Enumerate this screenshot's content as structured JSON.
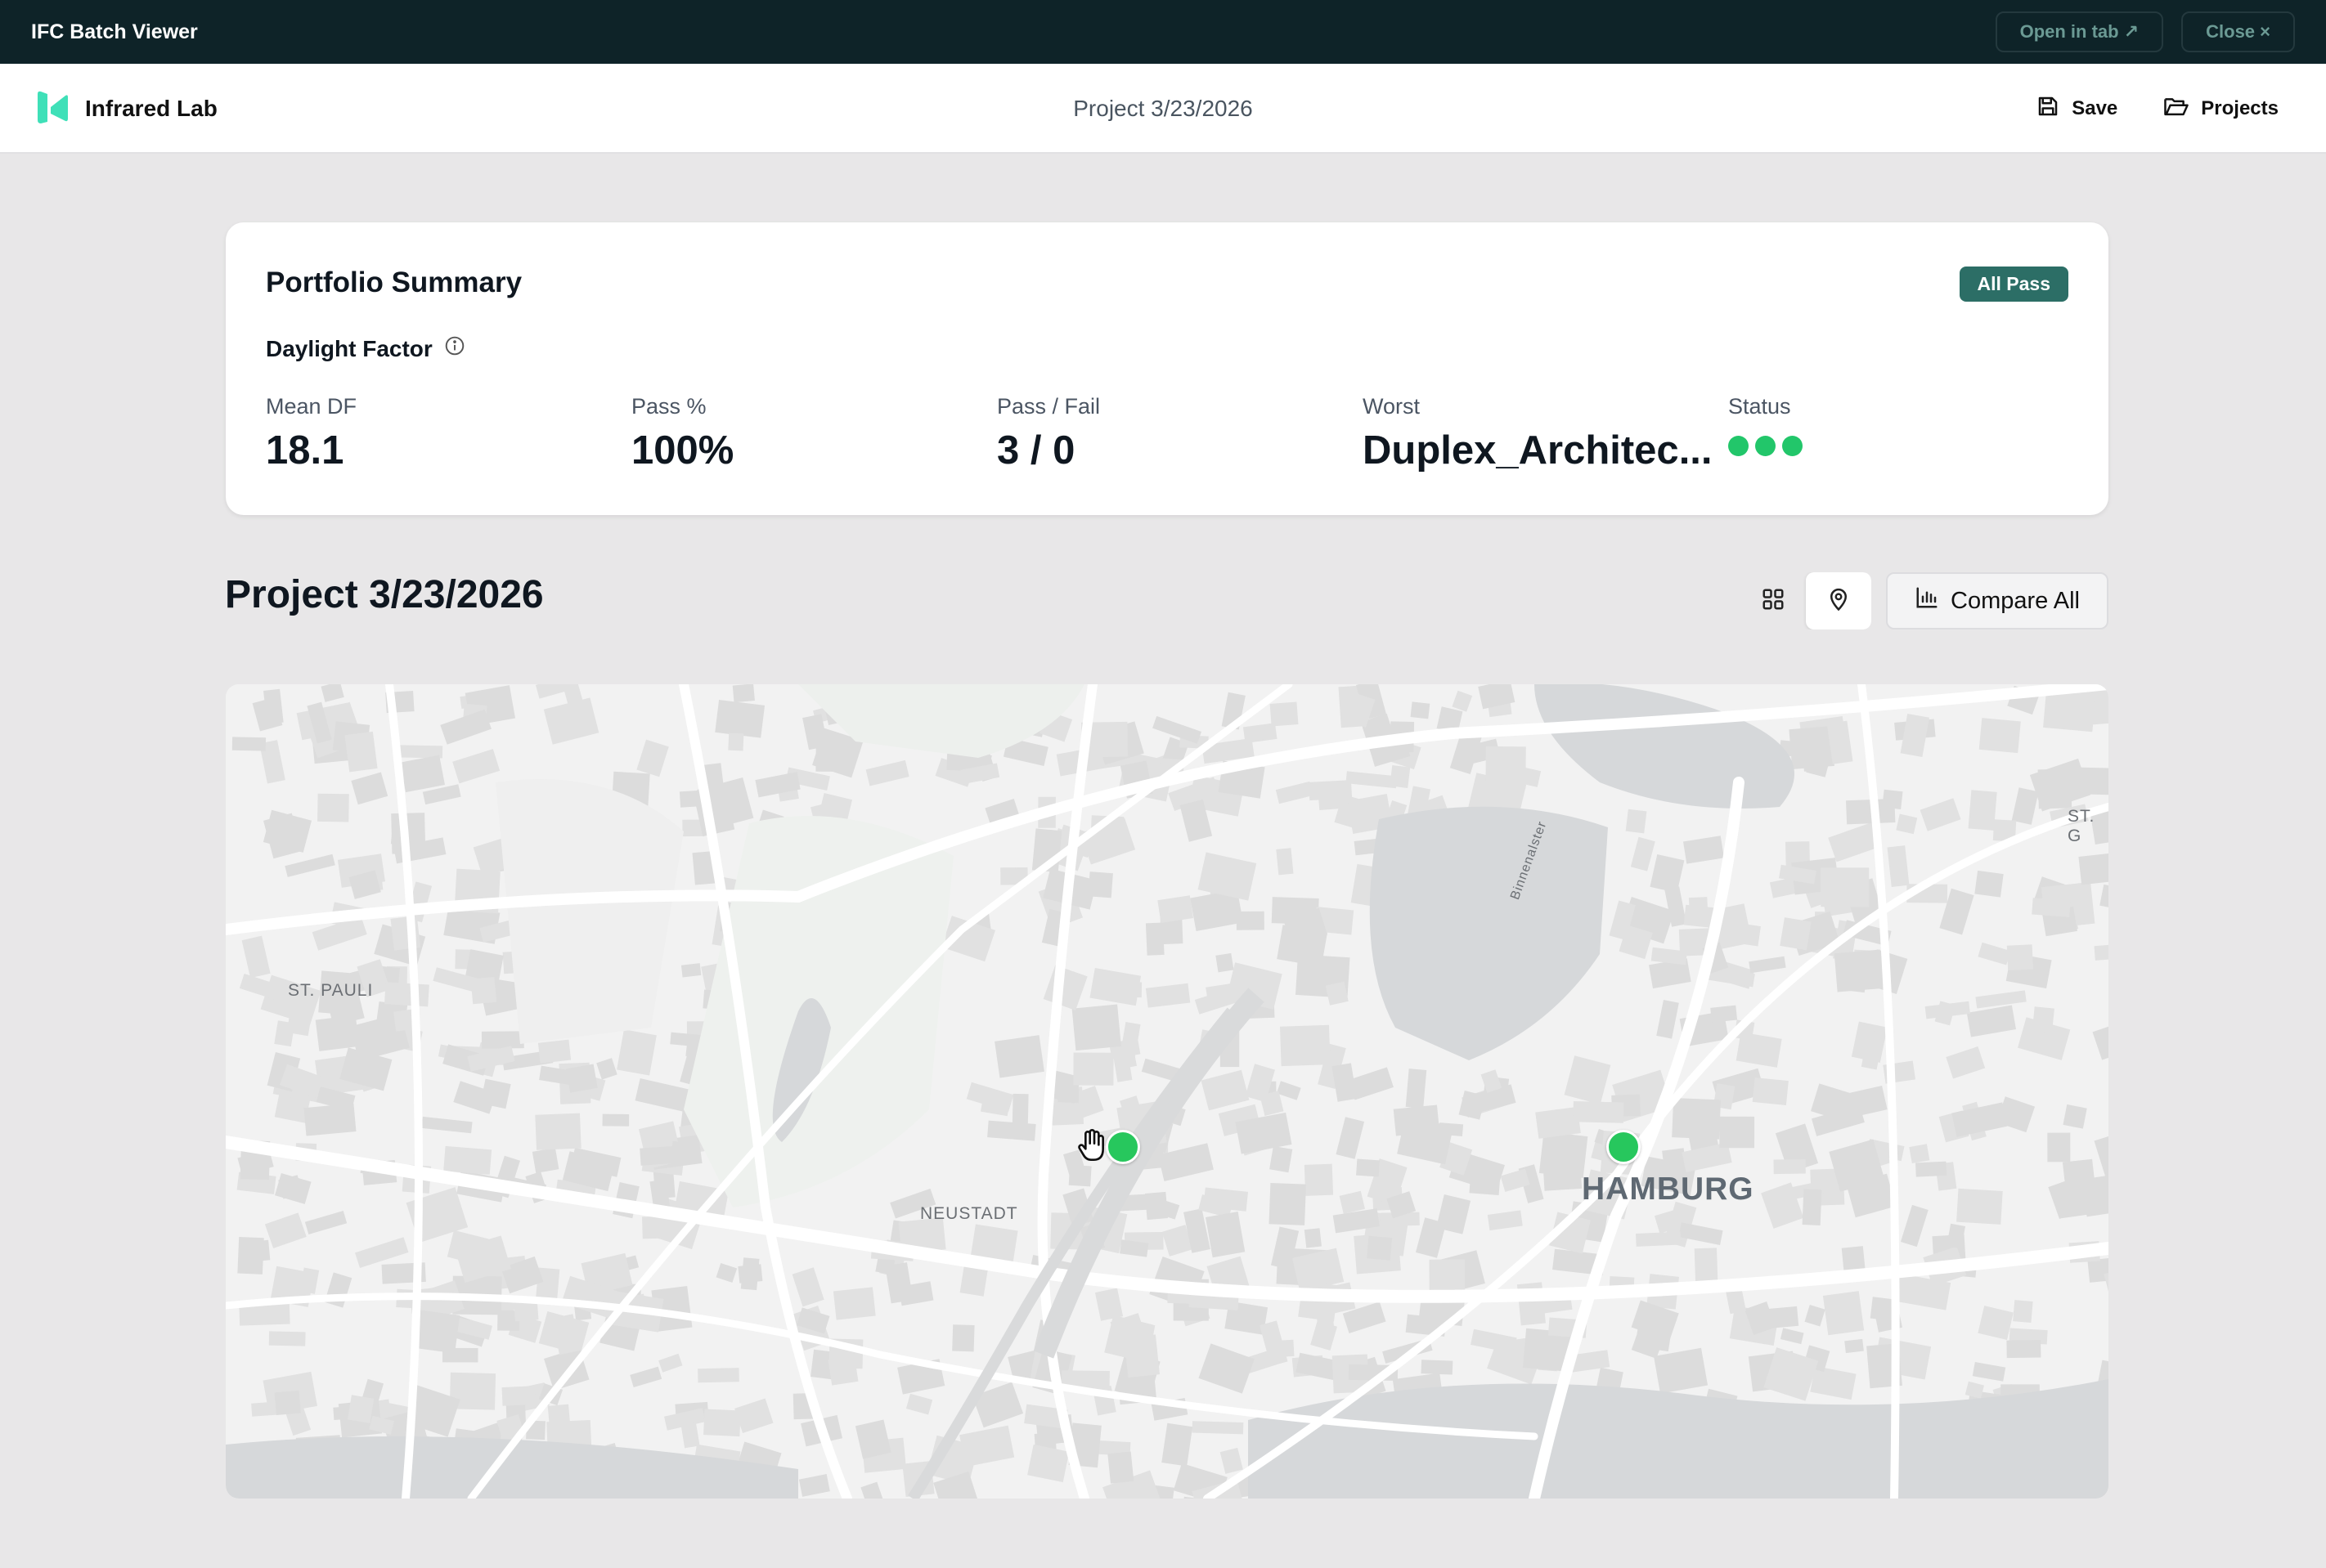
{
  "window": {
    "title": "IFC Batch Viewer",
    "open_in_tab": "Open in tab ↗",
    "close": "Close ×"
  },
  "header": {
    "brand": "Infrared Lab",
    "project": "Project 3/23/2026",
    "save": "Save",
    "projects": "Projects"
  },
  "summary": {
    "title": "Portfolio Summary",
    "badge": "All Pass",
    "metric": "Daylight Factor",
    "stats": [
      {
        "label": "Mean DF",
        "value": "18.1"
      },
      {
        "label": "Pass %",
        "value": "100%"
      },
      {
        "label": "Pass / Fail",
        "value": "3 / 0"
      },
      {
        "label": "Worst",
        "value": "Duplex_Architec..."
      },
      {
        "label": "Status"
      }
    ],
    "status_dots": 3,
    "status_color": "#22c66a"
  },
  "section": {
    "title": "Project 3/23/2026",
    "view_mode": "map",
    "compare_label": "Compare All"
  },
  "map": {
    "labels": {
      "st_pauli": "ST. PAULI",
      "neustadt": "NEUSTADT",
      "hamburg": "HAMBURG",
      "st_g": "ST. G",
      "binnenalster": "Binnenalster"
    },
    "marker_color": "#27c75d"
  },
  "colors": {
    "titlebar": "#0e2328",
    "badge": "#2c6e66",
    "brand_logo": "#3fe0b8"
  }
}
